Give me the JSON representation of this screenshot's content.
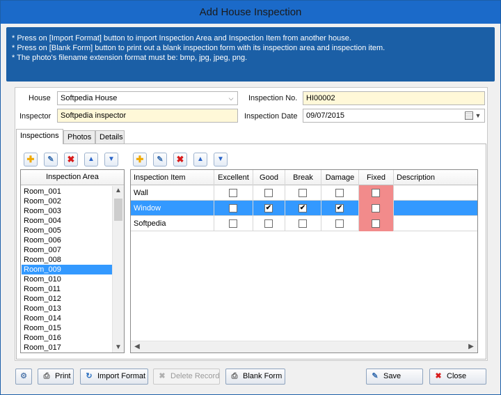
{
  "window": {
    "title": "Add House Inspection"
  },
  "info": {
    "lines": [
      "* Press on [Import Format] button to import Inspection Area and Inspection Item from another house.",
      "* Press on [Blank Form] button to print out a blank inspection form with its inspection area and inspection item.",
      "* The photo's filename extension format must be: bmp, jpg, jpeg, png."
    ]
  },
  "form": {
    "house_label": "House",
    "house_value": "Softpedia House",
    "inspector_label": "Inspector",
    "inspector_value": "Softpedia inspector",
    "inspection_no_label": "Inspection No.",
    "inspection_no_value": "HI00002",
    "inspection_date_label": "Inspection Date",
    "inspection_date_value": "09/07/2015"
  },
  "tabs": [
    "Inspections",
    "Photos",
    "Details"
  ],
  "area_list": {
    "header": "Inspection Area",
    "items": [
      "Room_001",
      "Room_002",
      "Room_003",
      "Room_004",
      "Room_005",
      "Room_006",
      "Room_007",
      "Room_008",
      "Room_009",
      "Room_010",
      "Room_011",
      "Room_012",
      "Room_013",
      "Room_014",
      "Room_015",
      "Room_016",
      "Room_017"
    ],
    "selected": "Room_009"
  },
  "item_grid": {
    "columns": [
      "Inspection Item",
      "Excellent",
      "Good",
      "Break",
      "Damage",
      "Fixed",
      "Description"
    ],
    "rows": [
      {
        "item": "Wall",
        "excellent": false,
        "good": false,
        "break": false,
        "damage": false,
        "fixed": false,
        "description": ""
      },
      {
        "item": "Window",
        "excellent": false,
        "good": true,
        "break": true,
        "damage": true,
        "fixed": false,
        "description": ""
      },
      {
        "item": "Softpedia",
        "excellent": false,
        "good": false,
        "break": false,
        "damage": false,
        "fixed": false,
        "description": ""
      }
    ],
    "selected_row": "Window"
  },
  "buttons": {
    "print": "Print",
    "import_format": "Import Format",
    "delete_record": "Delete Record",
    "blank_form": "Blank Form",
    "save": "Save",
    "close": "Close"
  },
  "colors": {
    "title_bar": "#1b6ac9",
    "info_box": "#1b5fa6",
    "selection": "#3399ff",
    "fixed_column": "#f28b8b",
    "required_field": "#fff8d8"
  }
}
